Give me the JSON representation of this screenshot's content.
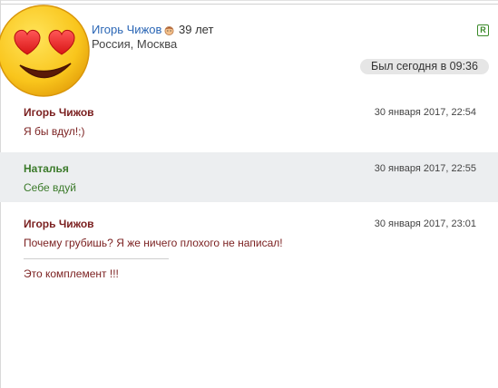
{
  "profile": {
    "name": "Игорь Чижов",
    "age": "39 лет",
    "location": "Россия, Москва",
    "badge": "R",
    "last_seen": "Был сегодня в 09:36"
  },
  "messages": [
    {
      "author": "Игорь Чижов",
      "time": "30 января 2017, 22:54",
      "text": "Я бы вдул!;)",
      "author_color": "#7a1f1f",
      "text_color": "#7a1f1f"
    },
    {
      "author": "Наталья",
      "time": "30 января 2017, 22:55",
      "text": "Себе вдуй",
      "author_color": "#3b7a2a",
      "text_color": "#3b7a2a"
    },
    {
      "author": "Игорь Чижов",
      "time": "30 января 2017, 23:01",
      "text": "Почему грубишь? Я же ничего плохого не написал!",
      "text2": "Это комплемент !!!",
      "author_color": "#7a1f1f",
      "text_color": "#7a1f1f"
    }
  ],
  "icons": {
    "avatar": "heart-eyes-emoji-icon",
    "age": "child-face-icon"
  }
}
